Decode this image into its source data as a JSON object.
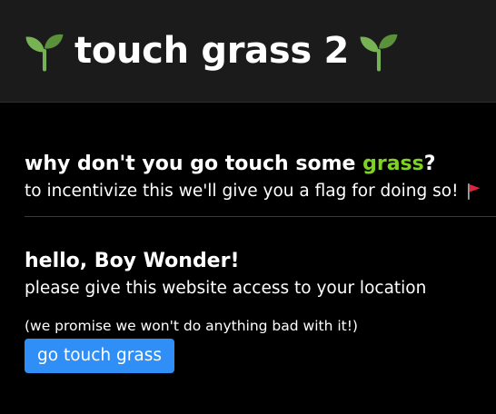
{
  "header": {
    "title": "touch grass 2",
    "icon_left": "seedling-icon",
    "icon_right": "seedling-icon"
  },
  "pitch": {
    "heading_before": "why don't you go touch some ",
    "heading_highlight": "grass",
    "heading_after": "?",
    "text": "to incentivize this we'll give you a flag for doing so!",
    "flag_icon": "red-flag-icon"
  },
  "location": {
    "greeting": "hello, Boy Wonder!",
    "request": "please give this website access to your location",
    "promise": "(we promise we won't do anything bad with it!)",
    "button_label": "go touch grass"
  },
  "colors": {
    "background": "#000000",
    "header_background": "#1b1b1b",
    "highlight_green": "#7ed321",
    "button_blue": "#2f8ff7",
    "flag_red": "#e0223a"
  }
}
